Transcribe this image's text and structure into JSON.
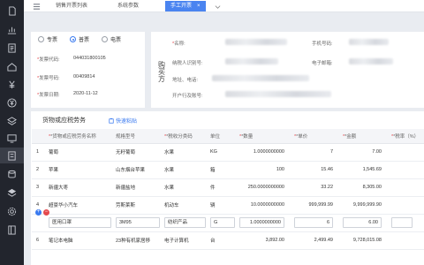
{
  "sidebar": {
    "icons": [
      "document-icon",
      "chart-icon",
      "invoice-icon",
      "home-icon",
      "yuan-icon",
      "yuan-circle-icon",
      "layers-icon",
      "board-icon",
      "ticket-icon",
      "database-icon",
      "stack-icon",
      "settings-icon",
      "book-icon"
    ]
  },
  "tabs": [
    {
      "label": "销售开票列表"
    },
    {
      "label": "系统参数"
    },
    {
      "label": "手工开票",
      "close": "×"
    }
  ],
  "invoice_type": {
    "options": [
      "专票",
      "普票",
      "电票"
    ],
    "selected": "普票"
  },
  "left_fields": {
    "code_label": "发票代码:",
    "code_value": "044031800105",
    "number_label": "发票号码:",
    "number_value": "00409814",
    "date_label": "发票日期:",
    "date_value": "2020-11-12"
  },
  "buyer": {
    "title": "购买方",
    "name_label": "名称:",
    "tax_label": "纳税人识别号:",
    "address_label": "地址、电话:",
    "bank_label": "开户行及账号:",
    "phone_label": "手机号码:",
    "email_label": "电子邮箱:"
  },
  "goods": {
    "title": "货物或应税劳务",
    "quick_paste": "快速粘贴",
    "columns": [
      "",
      "*货物或应税劳务名称",
      "规格型号",
      "*税收分类码",
      "单位",
      "*数量",
      "*单价",
      "*金额",
      "*税率（%）"
    ],
    "rows": [
      {
        "idx": "1",
        "name": "葡萄",
        "spec": "无籽葡萄",
        "cls": "水果",
        "unit": "KG",
        "qty": "1.0000000000",
        "price": "7",
        "amount": "7.00"
      },
      {
        "idx": "2",
        "name": "苹果",
        "spec": "山东烟台苹果",
        "cls": "水果",
        "unit": "箱",
        "qty": "100",
        "price": "15.46",
        "amount": "1,545.69"
      },
      {
        "idx": "3",
        "name": "新疆大枣",
        "spec": "新疆盐地",
        "cls": "水果",
        "unit": "件",
        "qty": "250.0000000000",
        "price": "33.22",
        "amount": "8,305.00"
      },
      {
        "idx": "4",
        "name": "超豪华小汽车",
        "spec": "劳斯莱斯",
        "cls": "机动车",
        "unit": "辆",
        "qty": "10.0000000000",
        "price": "999,999.99",
        "amount": "9,999,999.90"
      },
      {
        "idx": "",
        "name": "医用口罩",
        "spec": "3M95",
        "cls": "纺织产品",
        "unit": "G",
        "qty": "1.0000000000",
        "price": "6",
        "amount": "6.00",
        "edit": true
      },
      {
        "idx": "6",
        "name": "笔记本电脑",
        "spec": "23种有机家居移",
        "cls": "电子计算机",
        "unit": "台",
        "qty": "3,892.00",
        "price": "2,499.49",
        "amount": "9,728,015.08"
      }
    ]
  }
}
